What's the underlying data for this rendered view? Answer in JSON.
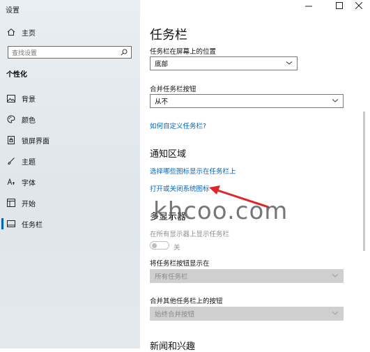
{
  "window": {
    "title": "设置",
    "minimize_icon": "minimize-icon",
    "maximize_icon": "maximize-icon",
    "close_icon": "close-icon"
  },
  "sidebar": {
    "home_label": "主页",
    "search_placeholder": "查找设置",
    "section_title": "个性化",
    "items": [
      {
        "label": "背景",
        "icon": "image-icon"
      },
      {
        "label": "颜色",
        "icon": "palette-icon"
      },
      {
        "label": "锁屏界面",
        "icon": "lockscreen-icon"
      },
      {
        "label": "主题",
        "icon": "brush-icon"
      },
      {
        "label": "字体",
        "icon": "font-icon"
      },
      {
        "label": "开始",
        "icon": "start-icon"
      },
      {
        "label": "任务栏",
        "icon": "taskbar-icon",
        "active": true
      }
    ]
  },
  "main": {
    "title": "任务栏",
    "position_label": "任务栏在屏幕上的位置",
    "position_value": "底部",
    "combine_label": "合并任务栏按钮",
    "combine_value": "从不",
    "customize_link": "如何自定义任务栏?",
    "notification_title": "通知区域",
    "select_icons_link": "选择哪些图标显示在任务栏上",
    "system_icons_link": "打开或关闭系统图标",
    "multi_display_title": "多显示器",
    "show_all_displays_label": "在所有显示器上显示任务栏",
    "toggle_state": "关",
    "show_buttons_on_label": "将任务栏按钮显示在",
    "show_buttons_on_value": "所有任务栏",
    "combine_other_label": "合并其他任务栏上的按钮",
    "combine_other_value": "始终合并按钮",
    "news_title": "新闻和兴趣"
  },
  "watermark": "khcoo.com",
  "colors": {
    "accent": "#0063b1",
    "link": "#0067c0",
    "arrow": "#e0262a"
  }
}
